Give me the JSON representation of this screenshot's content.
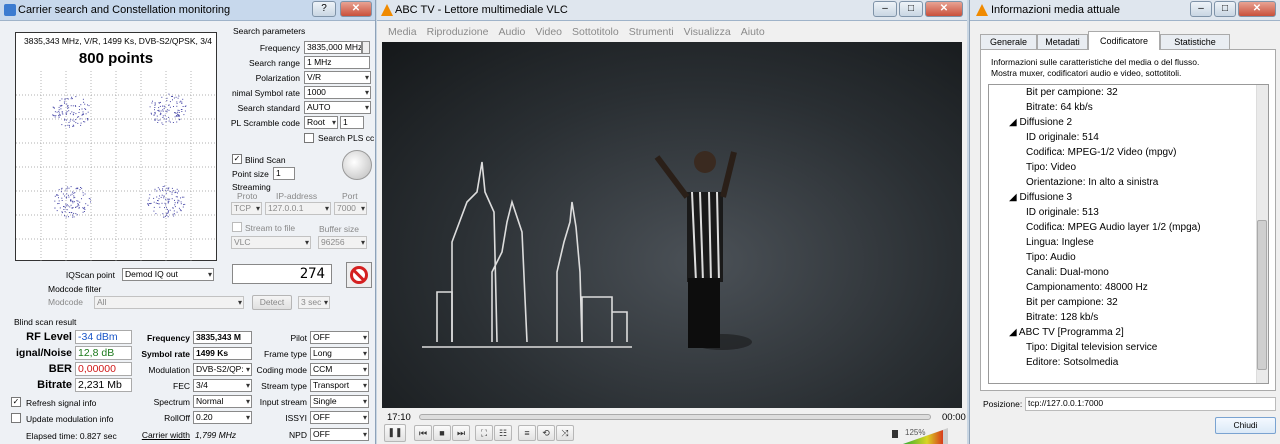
{
  "cs": {
    "title": "Carrier search and Constellation monitoring",
    "help": "?",
    "close": "✕",
    "info": "3835,343 MHz, V/R, 1499 Ks, DVB-S2/QPSK, 3/4",
    "points": "800 points",
    "sp_title": "Search parameters",
    "freq_l": "Frequency",
    "freq_v": "3835,000 MHz",
    "range_l": "Search range",
    "range_v": "1 MHz",
    "pol_l": "Polarization",
    "pol_v": "V/R",
    "sym_l": "nimal Symbol rate",
    "sym_v": "1000",
    "std_l": "Search standard",
    "std_v": "AUTO",
    "pls_l": "PL Scramble code",
    "pls_v": "Root",
    "pls_n": "1",
    "plsc_l": "Search PLS cc",
    "blind_l": "Blind Scan",
    "blind_c": "✓",
    "pts_l": "Point size",
    "pts_v": "1",
    "stream_l": "Streaming",
    "proto_l": "Proto",
    "ip_l": "IP-address",
    "port_l": "Port",
    "proto_v": "TCP",
    "ip_v": "127.0.0.1",
    "port_v": "7000",
    "file_l": "Stream to file",
    "buf_l": "Buffer size",
    "vlc_v": "VLC",
    "buf_v": "96256",
    "iq_l": "IQScan point",
    "iq_v": "Demod IQ out",
    "counter": "274",
    "mf_l": "Modcode filter",
    "mc_l": "Modcode",
    "mc_v": "All",
    "detect": "Detect",
    "sec": "3 sec",
    "bs_l": "Blind scan result",
    "rf_l": "RF Level",
    "rf_v": "-34 dBm",
    "snr_l": "ignal/Noise",
    "snr_v": "12,8 dB",
    "ber_l": "BER",
    "ber_v": "0,00000",
    "br_l": "Bitrate",
    "br_v": "2,231 Mb",
    "refresh_l": "Refresh signal info",
    "refresh_c": "✓",
    "upd_l": "Update modulation info",
    "elapsed": "Elapsed time: 0.827 sec",
    "f2_l": "Frequency",
    "f2_v": "3835,343 M",
    "sr_l": "Symbol rate",
    "sr_v": "1499 Ks",
    "mod_l": "Modulation",
    "mod_v": "DVB-S2/QP:",
    "fec_l": "FEC",
    "fec_v": "3/4",
    "spec_l": "Spectrum",
    "spec_v": "Normal",
    "ro_l": "RollOff",
    "ro_v": "0.20",
    "cw_l": "Carrier width",
    "cw_v": "1,799 MHz",
    "pilot_l": "Pilot",
    "pilot_v": "OFF",
    "ft_l": "Frame type",
    "ft_v": "Long",
    "cm_l": "Coding mode",
    "cm_v": "CCM",
    "st_l": "Stream type",
    "st_v": "Transport",
    "is_l": "Input stream",
    "is_v": "Single",
    "issy_l": "ISSYI",
    "issy_v": "OFF",
    "npd_l": "NPD",
    "npd_v": "OFF"
  },
  "vlc": {
    "title": "ABC TV - Lettore multimediale VLC",
    "menu": [
      "Media",
      "Riproduzione",
      "Audio",
      "Video",
      "Sottotitolo",
      "Strumenti",
      "Visualizza",
      "Aiuto"
    ],
    "time": "17:10",
    "end": "00:00",
    "vol": "125%",
    "progress": 0.0
  },
  "mi": {
    "title": "Informazioni media attuale",
    "tabs": [
      "Generale",
      "Metadati",
      "Codificatore",
      "Statistiche"
    ],
    "desc1": "Informazioni sulle caratteristiche del media o del flusso.",
    "desc2": "Mostra muxer, codificatori audio e video, sottotitoli.",
    "tree": [
      {
        "t": "Bit per campione: 32",
        "l": 2
      },
      {
        "t": "Bitrate: 64 kb/s",
        "l": 2
      },
      {
        "t": "Diffusione 2",
        "l": 1
      },
      {
        "t": "ID originale: 514",
        "l": 2
      },
      {
        "t": "Codifica: MPEG-1/2 Video (mpgv)",
        "l": 2
      },
      {
        "t": "Tipo: Video",
        "l": 2
      },
      {
        "t": "Orientazione: In alto a sinistra",
        "l": 2
      },
      {
        "t": "Diffusione 3",
        "l": 1
      },
      {
        "t": "ID originale: 513",
        "l": 2
      },
      {
        "t": "Codifica: MPEG Audio layer 1/2 (mpga)",
        "l": 2
      },
      {
        "t": "Lingua: Inglese",
        "l": 2
      },
      {
        "t": "Tipo: Audio",
        "l": 2
      },
      {
        "t": "Canali: Dual-mono",
        "l": 2
      },
      {
        "t": "Campionamento: 48000 Hz",
        "l": 2
      },
      {
        "t": "Bit per campione: 32",
        "l": 2
      },
      {
        "t": "Bitrate: 128 kb/s",
        "l": 2
      },
      {
        "t": "ABC TV [Programma 2]",
        "l": 1
      },
      {
        "t": "Tipo: Digital television service",
        "l": 2
      },
      {
        "t": "Editore: Sotsolmedia",
        "l": 2
      }
    ],
    "pos_l": "Posizione:",
    "pos_v": "tcp://127.0.0.1:7000",
    "close": "Chiudi"
  }
}
